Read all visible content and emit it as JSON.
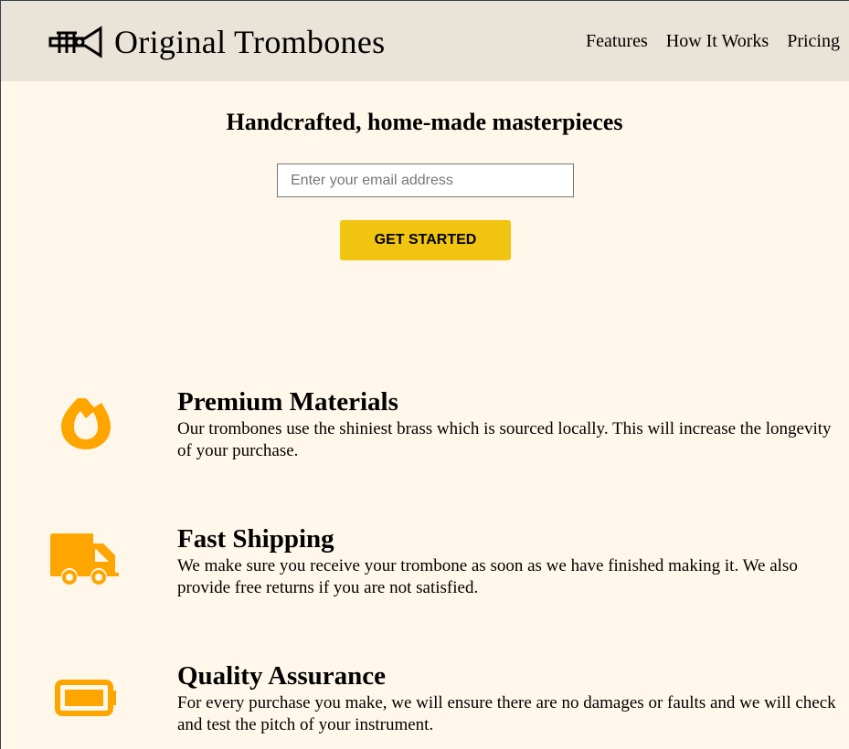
{
  "header": {
    "brand": "Original Trombones",
    "logo_icon": "trumpet-icon",
    "nav": [
      "Features",
      "How It Works",
      "Pricing"
    ]
  },
  "hero": {
    "title": "Handcrafted, home-made masterpieces",
    "email_placeholder": "Enter your email address",
    "cta": "GET STARTED"
  },
  "colors": {
    "accent": "#ffa500",
    "button": "#f1c40f",
    "header_bg": "#eae3d7",
    "page_bg": "#fff8ea"
  },
  "features": [
    {
      "icon": "fire-icon",
      "title": "Premium Materials",
      "text": "Our trombones use the shiniest brass which is sourced locally. This will increase the longevity of your purchase."
    },
    {
      "icon": "truck-icon",
      "title": "Fast Shipping",
      "text": "We make sure you receive your trombone as soon as we have finished making it. We also provide free returns if you are not satisfied."
    },
    {
      "icon": "battery-full-icon",
      "title": "Quality Assurance",
      "text": "For every purchase you make, we will ensure there are no damages or faults and we will check and test the pitch of your instrument."
    }
  ]
}
